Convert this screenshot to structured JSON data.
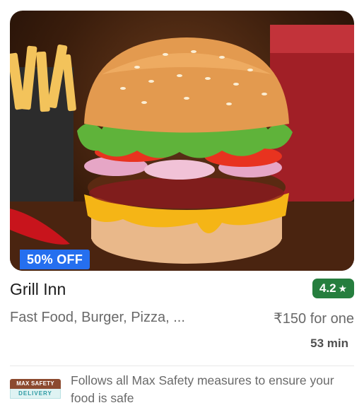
{
  "restaurant": {
    "name": "Grill Inn",
    "rating": "4.2",
    "cuisines": "Fast Food, Burger, Pizza, ...",
    "price": "₹150 for one",
    "delivery_time": "53 min",
    "offer": "50% OFF"
  },
  "safety": {
    "logo_top": "MAX SAFETY",
    "logo_bottom": "DELIVERY",
    "message": "Follows all Max Safety measures to ensure your food is safe"
  },
  "icons": {
    "rating": "star-icon"
  },
  "colors": {
    "offer_badge": "#256fef",
    "rating_badge": "#267e3e"
  }
}
